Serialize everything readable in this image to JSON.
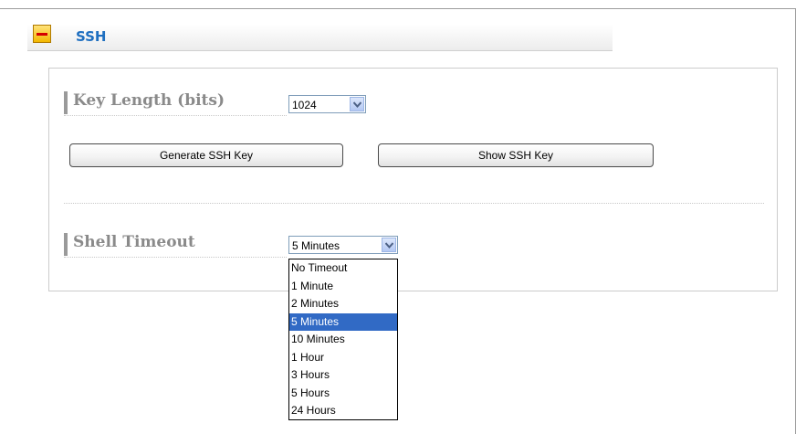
{
  "section": {
    "title": "SSH",
    "collapse_icon": "minus-icon"
  },
  "key_length": {
    "label": "Key Length (bits)",
    "value": "1024"
  },
  "buttons": {
    "generate": "Generate SSH Key",
    "show": "Show SSH Key"
  },
  "shell_timeout": {
    "label": "Shell Timeout",
    "value": "5 Minutes",
    "options": [
      "No Timeout",
      "1 Minute",
      "2 Minutes",
      "5 Minutes",
      "10 Minutes",
      "1 Hour",
      "3 Hours",
      "5 Hours",
      "24 Hours"
    ],
    "selected_index": 3
  },
  "colors": {
    "title": "#1f6fc0",
    "selection": "#316ac5",
    "label": "#8a8a8a"
  }
}
